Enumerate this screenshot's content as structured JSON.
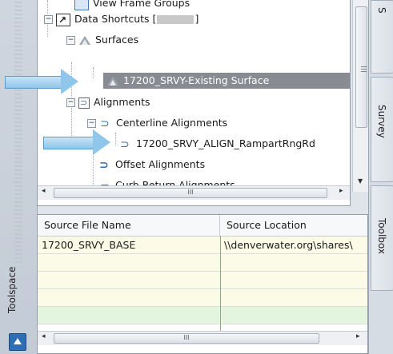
{
  "tree": {
    "items": [
      {
        "label": "View Frame Groups",
        "level": 2,
        "icon": "frame-group-icon"
      },
      {
        "label_prefix": "Data Shortcuts [",
        "label_suffix": "]",
        "level": 1,
        "icon": "shortcut-icon",
        "expanded": true
      },
      {
        "label": "Surfaces",
        "level": 2,
        "icon": "surfaces-icon",
        "expanded": true
      },
      {
        "label": "17200_SRVY-Existing Surface",
        "level": 3,
        "icon": "surface-icon",
        "selected": true
      },
      {
        "label": "Alignments",
        "level": 2,
        "icon": "alignments-icon",
        "expanded": true
      },
      {
        "label": "Centerline Alignments",
        "level": 3,
        "icon": "centerline-alignment-icon",
        "expanded": true
      },
      {
        "label": "17200_SRVY_ALIGN_RampartRngRd",
        "level": 4,
        "icon": "alignment-icon"
      },
      {
        "label": "Offset Alignments",
        "level": 3,
        "icon": "offset-alignment-icon"
      },
      {
        "label": "Curb Return Alignments",
        "level": 3,
        "icon": "curb-return-alignment-icon"
      }
    ],
    "hscroll_grip": "III"
  },
  "table": {
    "columns": [
      "Source File Name",
      "Source Location"
    ],
    "rows": [
      {
        "file": "17200_SRVY_BASE",
        "location": "\\\\denverwater.org\\shares\\"
      }
    ],
    "hscroll_grip": "III"
  },
  "side_tabs": {
    "left": "Toolspace",
    "right": [
      "S",
      "Survey",
      "Toolbox"
    ]
  },
  "colors": {
    "selection": "#888c92",
    "row_highlight": "#fbfbe8",
    "row_green": "#e3f5df",
    "callout_arrow": "#8fc6ea"
  }
}
